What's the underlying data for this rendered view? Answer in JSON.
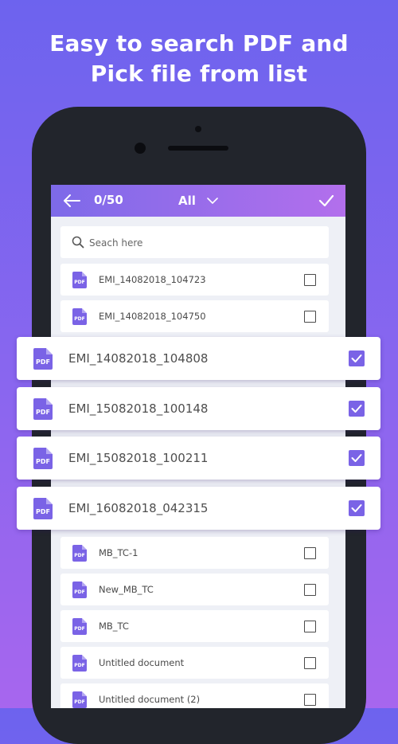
{
  "headline": {
    "line1": "Easy to search PDF and",
    "line2": "Pick file from list"
  },
  "appbar": {
    "back_icon": "arrow-left-icon",
    "selected_count": "0/50",
    "filter_label": "All",
    "filter_icon": "chevron-down-icon",
    "confirm_icon": "check-icon"
  },
  "search": {
    "placeholder": "Seach here",
    "icon": "search-icon"
  },
  "files": [
    {
      "name": "EMI_14082018_104723",
      "checked": false
    },
    {
      "name": "EMI_14082018_104750",
      "checked": false
    },
    {
      "name": "EMI_14082018_104808",
      "checked": true
    },
    {
      "name": "EMI_15082018_100148",
      "checked": true
    },
    {
      "name": "EMI_15082018_100211",
      "checked": true
    },
    {
      "name": "EMI_16082018_042315",
      "checked": true
    },
    {
      "name": "MB_TC-1",
      "checked": false
    },
    {
      "name": "New_MB_TC",
      "checked": false
    },
    {
      "name": "MB_TC",
      "checked": false
    },
    {
      "name": "Untitled document",
      "checked": false
    },
    {
      "name": "Untitled document (2)",
      "checked": false
    }
  ],
  "file_icon_label": "PDF",
  "colors": {
    "accent": "#7a63e6",
    "background_top": "#6d63ee",
    "background_bottom": "#a766ee"
  }
}
